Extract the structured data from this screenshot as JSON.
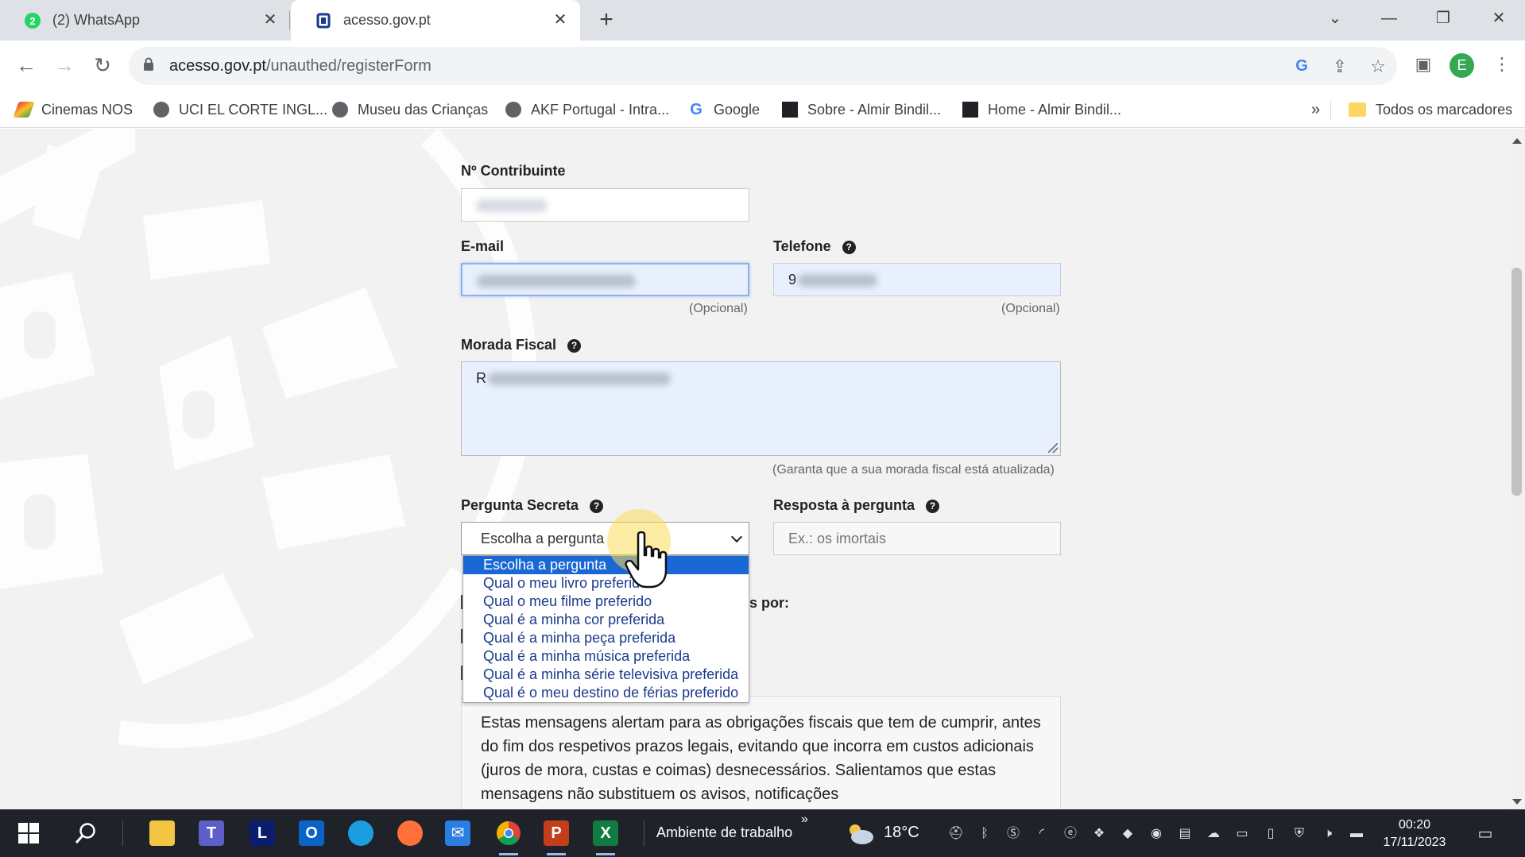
{
  "browser": {
    "tabs": [
      {
        "title": "(2) WhatsApp",
        "badge": "2",
        "active": false
      },
      {
        "title": "acesso.gov.pt",
        "active": true
      }
    ],
    "new_tab_symbol": "+",
    "url_host": "acesso.gov.pt",
    "url_path": "/unauthed/registerForm",
    "profile_initial": "E",
    "bookmarks": [
      {
        "label": "Cinemas NOS",
        "icon": "nos-icon"
      },
      {
        "label": "UCI EL CORTE INGL...",
        "icon": "globe-icon"
      },
      {
        "label": "Museu das Crianças",
        "icon": "globe-icon"
      },
      {
        "label": "AKF Portugal - Intra...",
        "icon": "globe-icon"
      },
      {
        "label": "Google",
        "icon": "google-icon"
      },
      {
        "label": "Sobre - Almir Bindil...",
        "icon": "site-icon"
      },
      {
        "label": "Home - Almir Bindil...",
        "icon": "site-icon"
      }
    ],
    "bookmarks_overflow": "»",
    "all_bookmarks": "Todos os marcadores"
  },
  "form": {
    "nif_label": "Nº Contribuinte",
    "email_label": "E-mail",
    "email_hint": "(Opcional)",
    "phone_label": "Telefone",
    "phone_value_start": "9",
    "phone_hint": "(Opcional)",
    "address_label": "Morada Fiscal",
    "address_value_start": "R",
    "address_hint": "(Garanta que a sua morada fiscal está atualizada)",
    "secret_question_label": "Pergunta Secreta",
    "secret_question_selected": "Escolha a pergunta",
    "secret_question_options": [
      "Escolha a pergunta",
      "Qual o meu livro preferido",
      "Qual o meu filme preferido",
      "Qual é a minha cor preferida",
      "Qual é a minha peça preferida",
      "Qual é a minha música preferida",
      "Qual é a minha série televisiva preferida",
      "Qual é o meu destino de férias preferido"
    ],
    "answer_label": "Resposta à pergunta",
    "answer_placeholder": "Ex.: os imortais",
    "partial_heading_end": "s por:",
    "info_text": "Estas mensagens alertam para as obrigações fiscais que tem de cumprir, antes do fim dos respetivos prazos legais, evitando que incorra em custos adicionais (juros de mora, custas e coimas) desnecessários. Salientamos que estas mensagens não substituem os avisos, notificações"
  },
  "taskbar": {
    "search_label": "Ambiente de trabalho",
    "chevron": "»",
    "temperature": "18°C",
    "time": "00:20",
    "date": "17/11/2023"
  }
}
